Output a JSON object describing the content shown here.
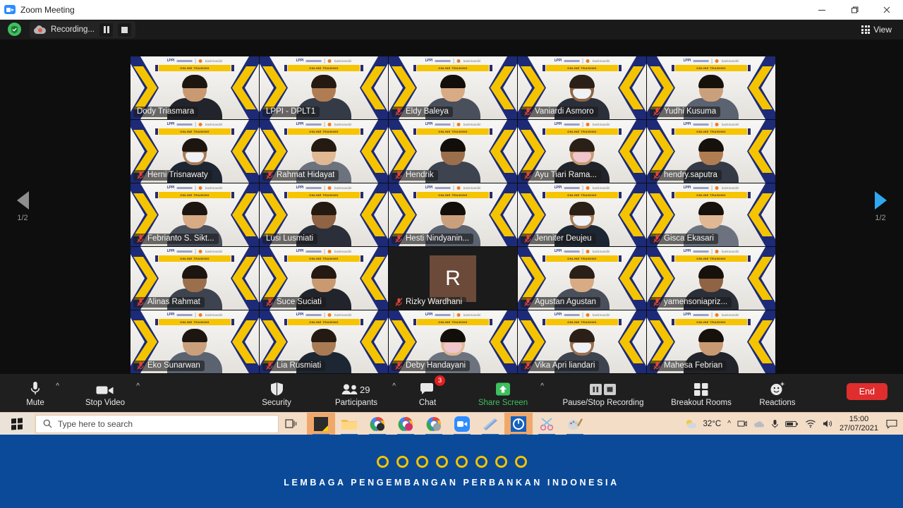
{
  "window": {
    "title": "Zoom Meeting",
    "app_icon": "zoom-icon",
    "minimize": "—",
    "maximize": "❐",
    "close": "✕"
  },
  "topbar": {
    "security_icon": "shield-check-icon",
    "recording_label": "Recording...",
    "pause_recording_icon": "pause-icon",
    "stop_recording_icon": "stop-icon",
    "view_label": "View",
    "view_icon": "grid-icon"
  },
  "gallery": {
    "prev_label": "1/2",
    "next_label": "1/2",
    "prev_icon": "chevron-left-icon",
    "next_icon": "chevron-right-icon",
    "banner_text": "ONLINE TRAINING",
    "logo_text": "LPPI",
    "logo_partner": "bankmandiri",
    "participants": [
      {
        "name": "Dody Triasmara",
        "muted": false,
        "active": false,
        "video": true
      },
      {
        "name": "LPPI - DPLT1",
        "muted": false,
        "active": true,
        "video": true
      },
      {
        "name": "Eldy Baleya",
        "muted": true,
        "active": false,
        "video": true
      },
      {
        "name": "Vaniardi Asmoro",
        "muted": true,
        "active": false,
        "video": true
      },
      {
        "name": "Yudhi Kusuma",
        "muted": true,
        "active": false,
        "video": true
      },
      {
        "name": "Herni Trisnawaty",
        "muted": true,
        "active": false,
        "video": true
      },
      {
        "name": "Rahmat Hidayat",
        "muted": true,
        "active": false,
        "video": true
      },
      {
        "name": "Hendrik",
        "muted": true,
        "active": false,
        "video": true
      },
      {
        "name": "Ayu Tiari Rama...",
        "muted": true,
        "active": false,
        "video": true
      },
      {
        "name": "hendry.saputra",
        "muted": true,
        "active": false,
        "video": true
      },
      {
        "name": "Febrianto S. Sikt...",
        "muted": true,
        "active": false,
        "video": true
      },
      {
        "name": "Lusi Lusmiati",
        "muted": false,
        "active": false,
        "video": true
      },
      {
        "name": "Hesti Nindyanin...",
        "muted": true,
        "active": false,
        "video": true
      },
      {
        "name": "Jenniter Deujeu",
        "muted": true,
        "active": false,
        "video": true
      },
      {
        "name": "Gisca Ekasari",
        "muted": true,
        "active": false,
        "video": true
      },
      {
        "name": "Alinas Rahmat",
        "muted": true,
        "active": false,
        "video": true
      },
      {
        "name": "Suce Suciati",
        "muted": true,
        "active": false,
        "video": true
      },
      {
        "name": "Rizky Wardhani",
        "muted": true,
        "active": false,
        "video": false,
        "avatar_initial": "R"
      },
      {
        "name": "Agustan Agustan",
        "muted": true,
        "active": false,
        "video": true
      },
      {
        "name": "yamensoniapriz...",
        "muted": true,
        "active": false,
        "video": true
      },
      {
        "name": "Eko Sunarwan",
        "muted": true,
        "active": false,
        "video": true
      },
      {
        "name": "Lia Rusmiati",
        "muted": true,
        "active": false,
        "video": true
      },
      {
        "name": "Deby Handayani",
        "muted": true,
        "active": false,
        "video": true
      },
      {
        "name": "Vika Apri liandari",
        "muted": true,
        "active": false,
        "video": true
      },
      {
        "name": "Mahesa Febrian",
        "muted": true,
        "active": false,
        "video": true
      }
    ]
  },
  "toolbar": {
    "mute_label": "Mute",
    "mute_icon": "microphone-icon",
    "video_label": "Stop Video",
    "video_icon": "camera-icon",
    "security_label": "Security",
    "security_icon": "shield-icon",
    "participants_label": "Participants",
    "participants_icon": "people-icon",
    "participants_count": "29",
    "chat_label": "Chat",
    "chat_icon": "chat-bubble-icon",
    "chat_badge": "3",
    "share_label": "Share Screen",
    "share_icon": "up-arrow-icon",
    "recording_label": "Pause/Stop Recording",
    "breakout_label": "Breakout Rooms",
    "breakout_icon": "grid-squares-icon",
    "reactions_label": "Reactions",
    "reactions_icon": "smiley-icon",
    "end_label": "End",
    "share_color": "#3fbf5f",
    "end_color": "#e02d2d"
  },
  "taskbar": {
    "start_icon": "windows-logo-icon",
    "search_placeholder": "Type here to search",
    "search_icon": "search-icon",
    "taskview_icon": "task-view-icon",
    "apps": [
      {
        "name": "sticky-notes",
        "highlighted": true
      },
      {
        "name": "file-explorer",
        "highlighted": false
      },
      {
        "name": "chrome-profile-1",
        "highlighted": false
      },
      {
        "name": "chrome-profile-2",
        "highlighted": false
      },
      {
        "name": "chrome-profile-3",
        "highlighted": false
      },
      {
        "name": "zoom",
        "highlighted": false
      },
      {
        "name": "onenote",
        "highlighted": false
      },
      {
        "name": "blue-app",
        "highlighted": true
      },
      {
        "name": "snipping-tool",
        "highlighted": false
      },
      {
        "name": "paint",
        "highlighted": false
      }
    ],
    "weather_temp": "32°C",
    "weather_icon": "partly-cloudy-icon",
    "tray_icons": [
      "chevron-up-icon",
      "webcam-icon",
      "onedrive-icon",
      "microphone-icon",
      "battery-icon",
      "wifi-icon",
      "volume-icon"
    ],
    "time": "15:00",
    "date": "27/07/2021",
    "notification_icon": "notification-icon"
  },
  "bottom_banner": {
    "text": "LEMBAGA PENGEMBANGAN PERBANKAN INDONESIA",
    "dot_count": 8,
    "bg_color": "#0b4a99",
    "dot_color": "#f2c300"
  }
}
